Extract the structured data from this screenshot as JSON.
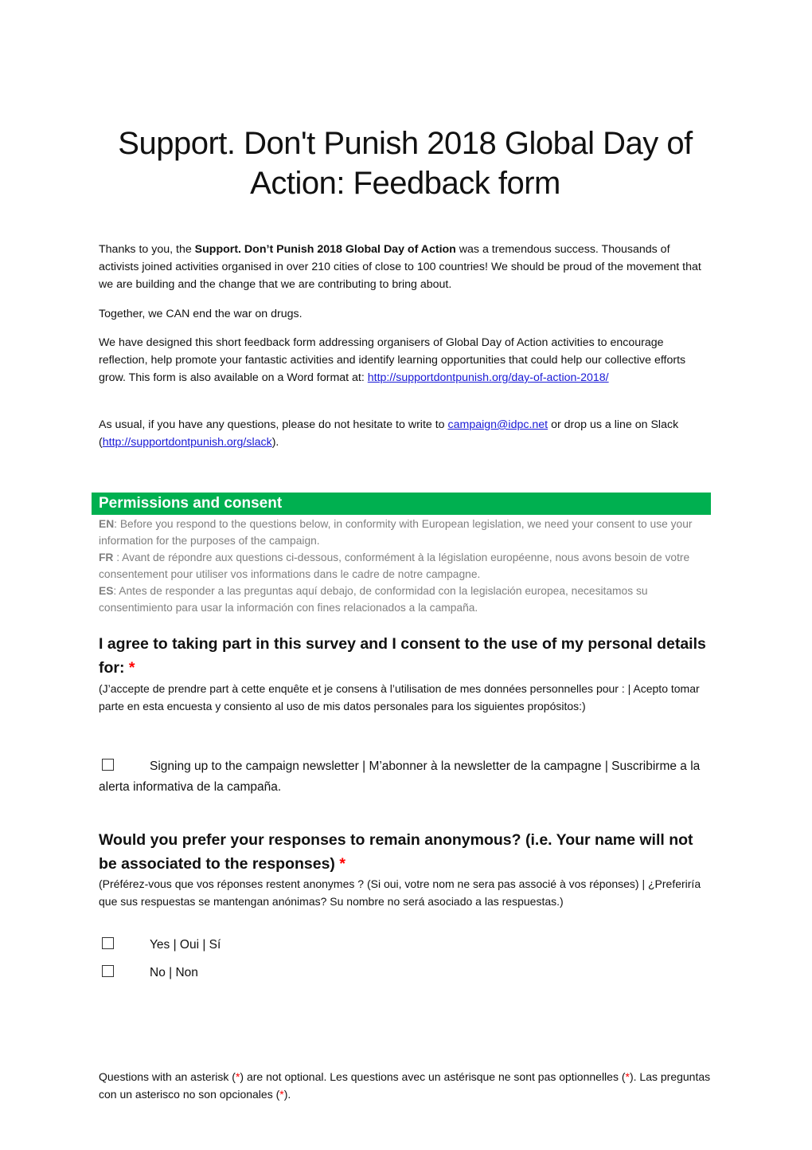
{
  "document": {
    "title": "Support. Don't Punish 2018 Global Day of Action: Feedback form",
    "intro": {
      "p1_before": "Thanks to you, the ",
      "p1_bold": "Support. Don’t Punish 2018 Global Day of Action",
      "p1_after": " was a tremendous success. Thousands of activists joined activities organised in over 210 cities of close to 100 countries! We should be proud of the movement that we are building and the change that we are contributing to bring about.",
      "p2": "Together, we CAN end the war on drugs.",
      "p3_text": "We have designed this short feedback form addressing organisers of Global Day of Action activities to encourage reflection, help promote your fantastic activities and identify learning opportunities that could help our collective efforts grow. This form is also available on a Word format at: ",
      "p3_link": "http://supportdontpunish.org/day-of-action-2018/",
      "p4_before": "As usual, if you have any questions, please do not hesitate to write to ",
      "p4_email": "campaign@idpc.net",
      "p4_middle": " or drop us a line on Slack (",
      "p4_slack_link": "http://supportdontpunish.org/slack",
      "p4_after": ")."
    },
    "section": {
      "title": "Permissions and consent",
      "color": "#00b050",
      "en_label": "EN",
      "en_text": ": Before you respond to the questions below, in conformity with European legislation, we need your consent to use your information for the purposes of the campaign.",
      "fr_label": "FR",
      "fr_text": " : Avant de répondre aux questions ci-dessous, conformément à la législation européenne, nous avons besoin de votre consentement pour utiliser vos informations dans le cadre de notre campagne.",
      "es_label": "ES",
      "es_text": ": Antes de responder a las preguntas aquí debajo, de conformidad con la legislación europea, necesitamos su consentimiento para usar la información con fines relacionados a la campaña."
    },
    "question1": {
      "title": "I agree to taking part in this survey and I consent to the use of my personal details for: ",
      "required_mark": "*",
      "subtitle": "(J’accepte de prendre part à cette enquête et je consens à l’utilisation de mes données personnelles pour : | Acepto tomar parte en esta encuesta y consiento al uso de mis datos personales para los siguientes propósitos:)",
      "options": [
        {
          "label": "Signing up to the campaign newsletter | M’abonner à la newsletter de la campagne  | Suscribirme a la alerta informativa de la campaña.",
          "checked": false
        }
      ]
    },
    "question2": {
      "title": "Would you prefer your responses to remain anonymous? (i.e. Your name will not be associated to the responses) ",
      "required_mark": "*",
      "subtitle": "(Préférez-vous que vos réponses restent anonymes ? (Si oui, votre nom ne sera pas associé à vos réponses)  | ¿Preferiría que sus respuestas se mantengan anónimas? Su nombre no será asociado a las respuestas.)",
      "options": [
        {
          "label": "Yes | Oui | Sí",
          "checked": false
        },
        {
          "label": "No | Non",
          "checked": false
        }
      ]
    },
    "footer": {
      "part1": "Questions with an asterisk (",
      "star": "*",
      "part2": ") are not optional. Les questions avec un astérisque ne sont pas optionnelles (",
      "part3": "). Las preguntas con un asterisco no son opcionales (",
      "part4": ")."
    }
  }
}
